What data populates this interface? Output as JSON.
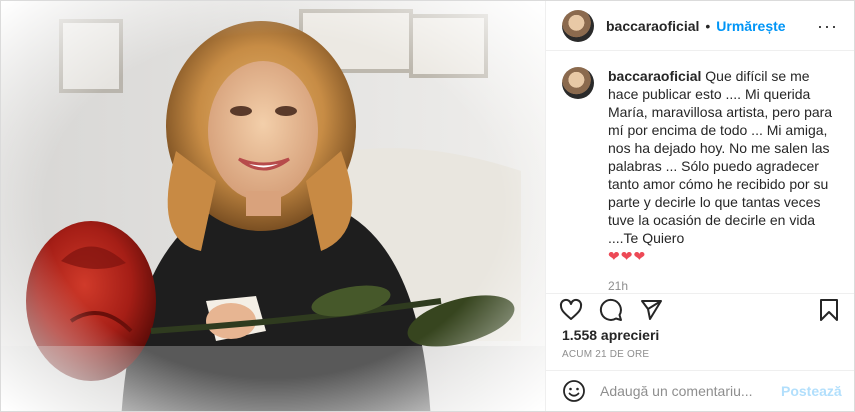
{
  "post": {
    "username": "baccaraoficial",
    "follow_label": "Urmărește",
    "more_label": "···",
    "caption_text": " Que difícil se me hace publicar esto .... Mi querida María, maravillosa artista, pero para mí por encima de todo ... Mi amiga, nos ha dejado hoy. No me salen las palabras ... Sólo puedo agradecer tanto amor cómo he recibido por su parte y decirle lo que tantas veces tuve la ocasión de decirle en vida ....Te Quiero ",
    "caption_hearts": "❤❤❤",
    "caption_time": "21h",
    "likes": "1.558 aprecieri",
    "time_ago": "ACUM 21 DE ORE",
    "comment_placeholder": "Adaugă un comentariu...",
    "post_button": "Postează"
  },
  "icons": {
    "like": "heart-icon",
    "comment": "comment-icon",
    "share": "share-icon",
    "save": "bookmark-icon",
    "emoji": "emoji-icon",
    "more": "more-icon"
  },
  "colors": {
    "link_blue": "#0095f6",
    "post_disabled": "#b2dffc",
    "heart_red": "#ed4956",
    "muted": "#8e8e8e"
  }
}
